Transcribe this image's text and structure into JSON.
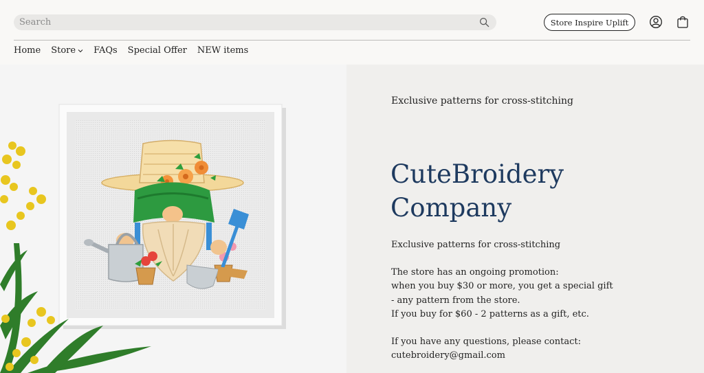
{
  "header": {
    "search": {
      "placeholder": "Search",
      "value": ""
    },
    "cta_label": "Store Inspire Uplift",
    "icons": [
      "search-icon",
      "account-icon",
      "cart-icon"
    ]
  },
  "nav": {
    "items": [
      {
        "label": "Home"
      },
      {
        "label": "Store",
        "has_dropdown": true
      },
      {
        "label": "FAQs"
      },
      {
        "label": "Special Offer"
      },
      {
        "label": "NEW items"
      }
    ]
  },
  "hero": {
    "kicker": "Exclusive patterns for cross-stitching",
    "title_line1": "CuteBroidery",
    "title_line2": "Company",
    "subtitle": "Exclusive patterns for cross-stitching",
    "promo_lines": [
      "The store has an ongoing promotion:",
      "when you buy $30 or more, you get a special gift",
      "- any pattern from the store.",
      "If you buy for $60 - 2 patterns as a gift, etc."
    ],
    "contact_line": "If you have any questions, please contact:",
    "email": "cutebroidery@gmail.com"
  },
  "colors": {
    "title": "#1e3a5f",
    "page_background": "#f7f6f4",
    "hero_panel": "#f0efed"
  }
}
